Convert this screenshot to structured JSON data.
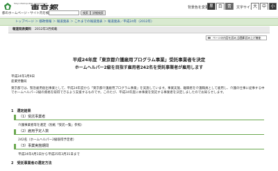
{
  "header": {
    "logo_small": "Tokyo Metropolitan Government",
    "logo_text": "東京都",
    "foreign_language": "Foreign language",
    "color_label": "背景色を変更",
    "text_size_label": "文字サイズ",
    "color_buttons": [
      "黒",
      "白",
      "青"
    ],
    "size_buttons": [
      "大",
      "中",
      "小"
    ]
  },
  "search": {
    "label": "都のホームページ・サイト内を検索する",
    "placeholder": "",
    "search_button": "検索",
    "detail_button": "詳細検索"
  },
  "breadcrumb": {
    "text": "トップページ ＞ 都政情報 ＞ 報道発表 ＞ これまでの報道発表 ＞ 報道発表／平成24年（2012年）"
  },
  "content_header": {
    "category": "報道発表資料",
    "date": "2012年3月掲載"
  },
  "toolbar": {
    "text": "ページの内容を読み上げる",
    "text2": "音声読み上げ機能"
  },
  "article": {
    "title": "平成24年度「東京都介護雇用プログラム事業」受託事業者を決定",
    "subtitle": "ホームヘルパー2級を目指す雇用者242名を受託事業者が雇用します",
    "date_line": "平成24年3月9日",
    "department": "産業労働局",
    "paragraph": "東京都では、緊急雇用創出事業として、平成24年度から「東京都介護雇用プログラム事業」を実施しています。事業実施、離職者を介護職員として雇用し、介護の仕事に従事する中でホームヘルパー2級の資格を取得できるよう支援するものです。このたび、平成24年度に本事業を受託する事業者を決定しましたのでお知らせします。",
    "sec1": "1　選定結果",
    "sub1": "（1）受託事業者",
    "item1": "介護事業者等を選定（別紙「受託一覧」参照）",
    "sub2": "（2）雇用予定人数",
    "item2": "242名（ホームヘルパー2級取得予定者）",
    "sub3": "（3）事業実施期間",
    "item3": "平成24年4月1日から平成25年3月31日まで",
    "sec2": "2　受託事業者の選定方法"
  }
}
